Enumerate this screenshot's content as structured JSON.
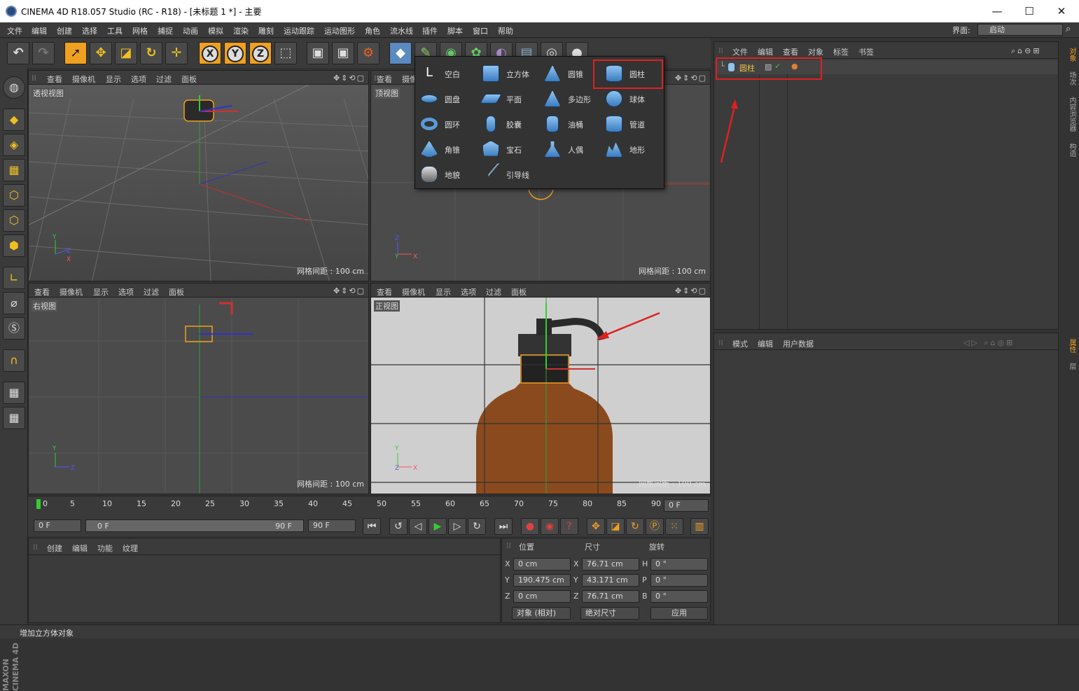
{
  "window": {
    "title": "CINEMA 4D R18.057 Studio (RC - R18) - [未标题 1 *] - 主要",
    "minimize": "—",
    "maximize": "☐",
    "close": "✕"
  },
  "menu": [
    "文件",
    "编辑",
    "创建",
    "选择",
    "工具",
    "网格",
    "捕捉",
    "动画",
    "模拟",
    "渲染",
    "雕刻",
    "运动跟踪",
    "运动图形",
    "角色",
    "流水线",
    "插件",
    "脚本",
    "窗口",
    "帮助"
  ],
  "layout": {
    "label": "界面:",
    "value": "启动"
  },
  "viewports": {
    "menu": [
      "查看",
      "摄像机",
      "显示",
      "选项",
      "过滤",
      "面板"
    ],
    "perspective": {
      "name": "透视视图",
      "grid": "网格间距 : 100 cm"
    },
    "top": {
      "name": "顶视图",
      "grid": "网格间距 : 100 cm"
    },
    "right": {
      "name": "右视图",
      "grid": "网格间距 : 100 cm"
    },
    "front": {
      "name": "正视图",
      "grid": "网格间距 : 100 cm"
    }
  },
  "popup": {
    "items": [
      [
        "空白",
        "立方体",
        "圆锥",
        "圆柱"
      ],
      [
        "圆盘",
        "平面",
        "多边形",
        "球体"
      ],
      [
        "圆环",
        "胶囊",
        "油桶",
        "管道"
      ],
      [
        "角锥",
        "宝石",
        "人偶",
        "地形"
      ],
      [
        "地貌",
        "引导线"
      ]
    ]
  },
  "object_manager": {
    "menu": [
      "文件",
      "编辑",
      "查看",
      "对象",
      "标签",
      "书签"
    ],
    "object_name": "圆柱"
  },
  "attribute_manager": {
    "menu": [
      "模式",
      "编辑",
      "用户数据"
    ]
  },
  "right_tabs": [
    "对象",
    "场次",
    "内容浏览器",
    "构造",
    "属性",
    "层"
  ],
  "timeline": {
    "ticks": [
      "0",
      "5",
      "10",
      "15",
      "20",
      "25",
      "30",
      "35",
      "40",
      "45",
      "50",
      "55",
      "60",
      "65",
      "70",
      "75",
      "80",
      "85",
      "90"
    ],
    "current_frame": "0 F"
  },
  "transport": {
    "start": "0 F",
    "range_start": "0 F",
    "range_end": "90 F",
    "end": "90 F"
  },
  "material_manager": {
    "menu": [
      "创建",
      "编辑",
      "功能",
      "纹理"
    ]
  },
  "coordinates": {
    "headers": [
      "位置",
      "尺寸",
      "旋转"
    ],
    "rows": [
      {
        "axis": "X",
        "pos": "0 cm",
        "size_axis": "X",
        "size": "76.71 cm",
        "rot_axis": "H",
        "rot": "0 °"
      },
      {
        "axis": "Y",
        "pos": "190.475 cm",
        "size_axis": "Y",
        "size": "43.171 cm",
        "rot_axis": "P",
        "rot": "0 °"
      },
      {
        "axis": "Z",
        "pos": "0 cm",
        "size_axis": "Z",
        "size": "76.71 cm",
        "rot_axis": "B",
        "rot": "0 °"
      }
    ],
    "mode": "对象 (相对)",
    "size_mode": "绝对尺寸",
    "apply": "应用"
  },
  "status": "增加立方体对象",
  "brand": "MAXON CINEMA 4D",
  "colors": {
    "accent": "#f0a020",
    "highlight": "#e02020",
    "bg": "#333333"
  }
}
